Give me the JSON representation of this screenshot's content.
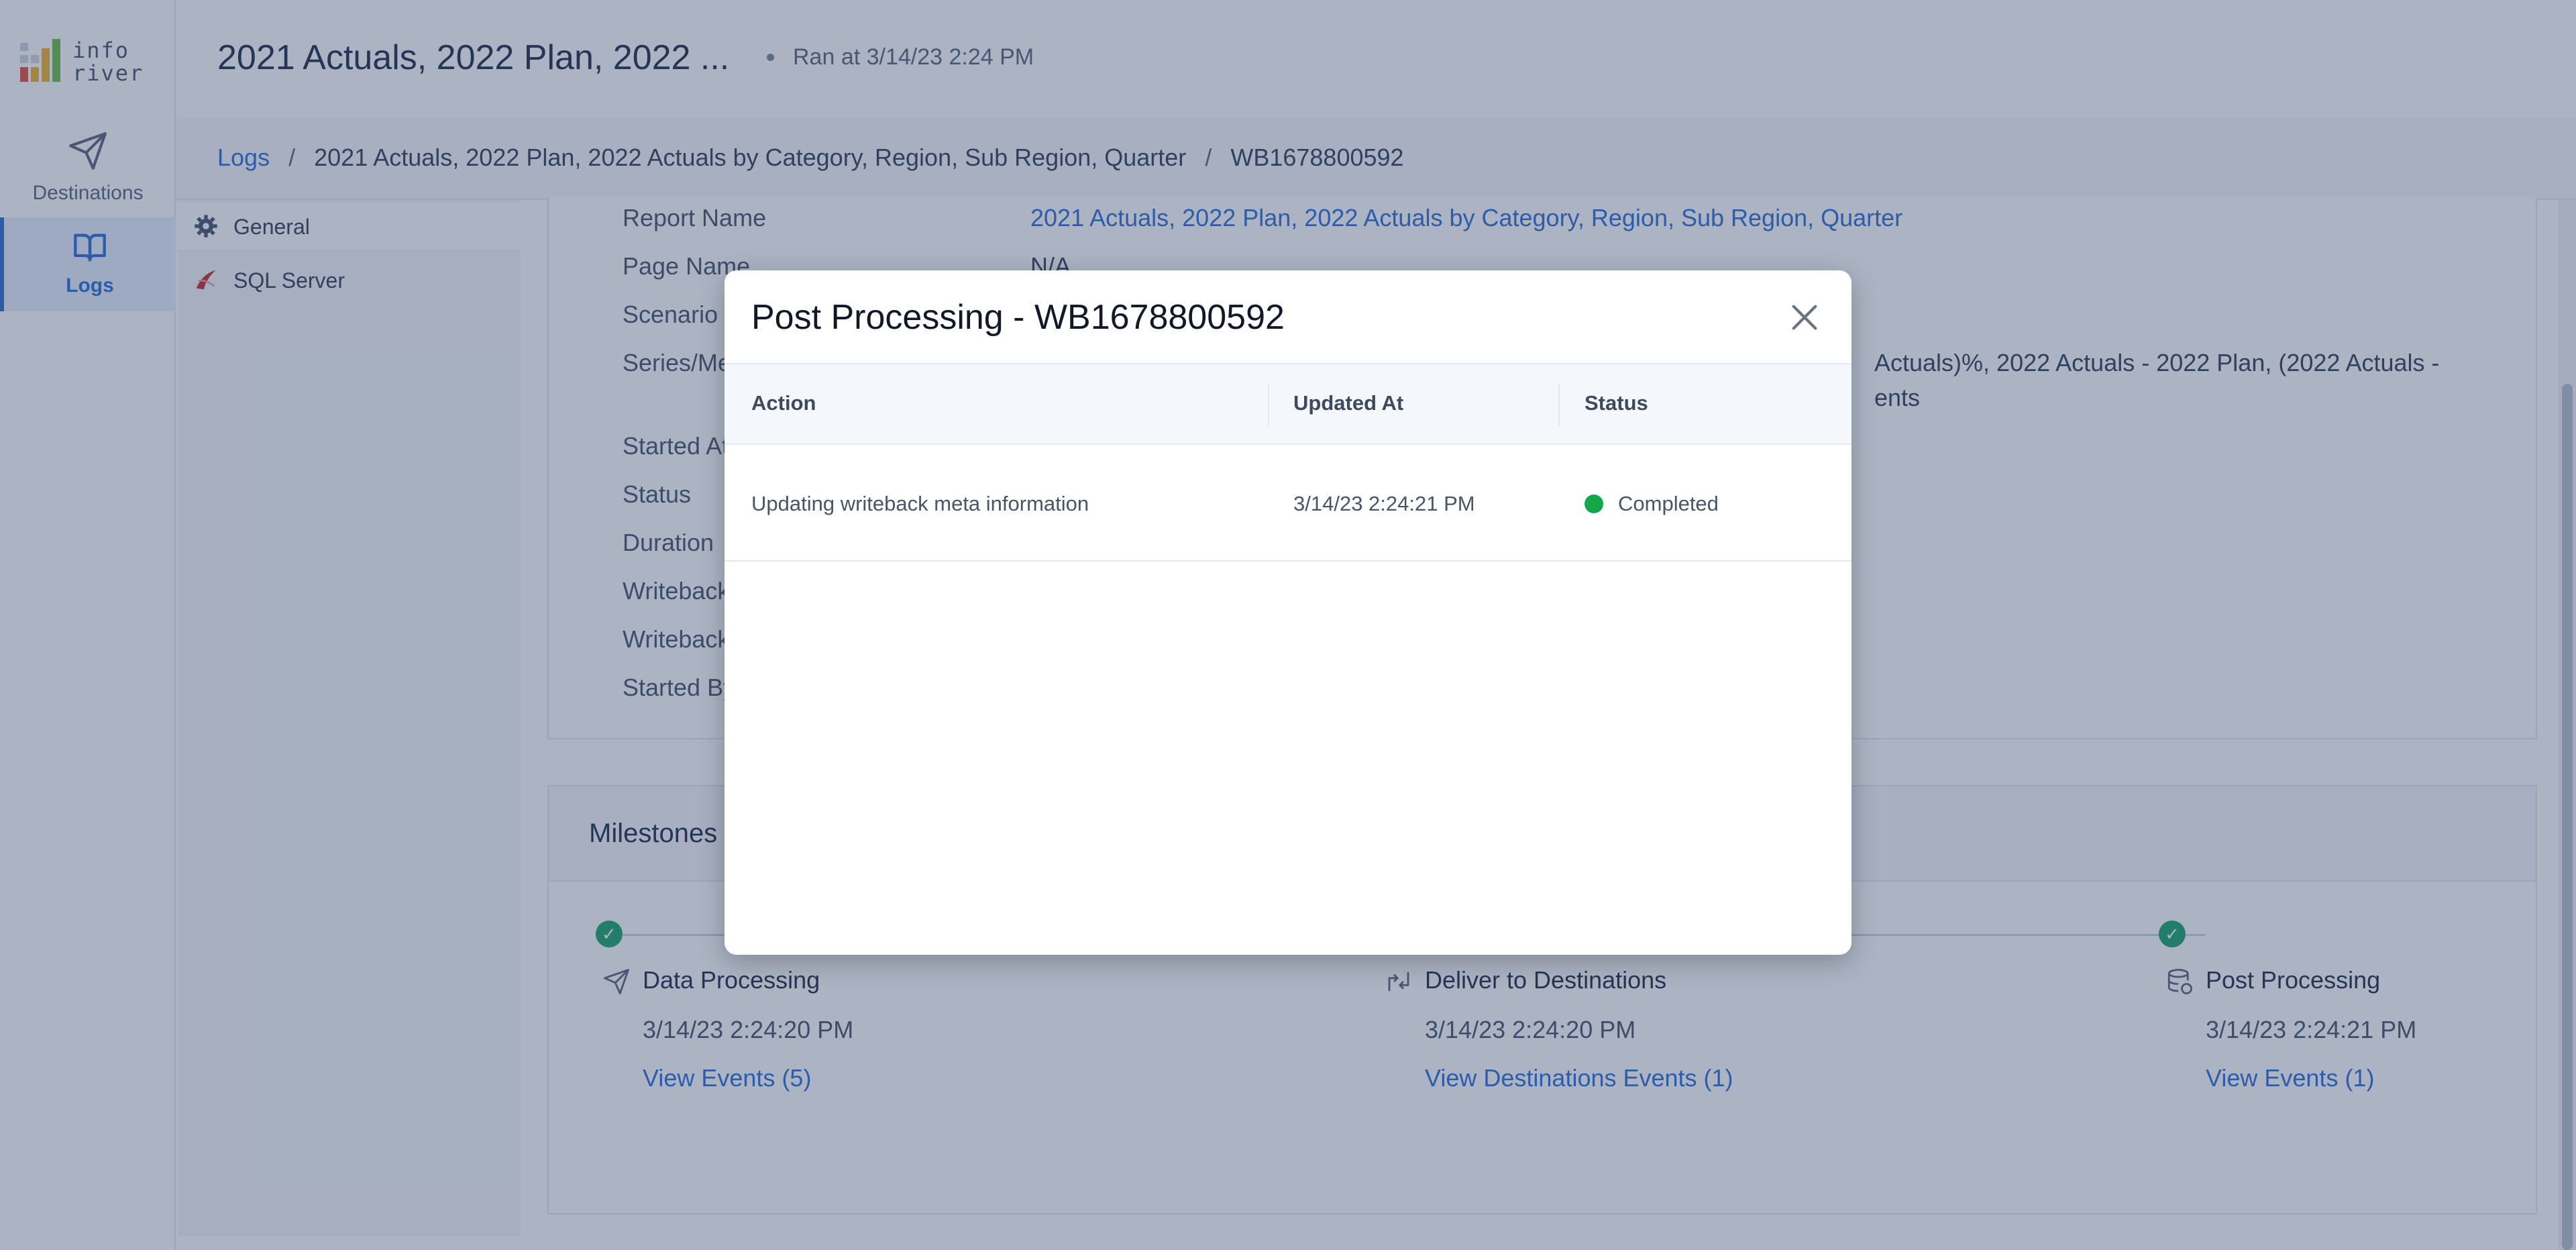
{
  "app": {
    "logo_text_line1": "info",
    "logo_text_line2": "river"
  },
  "header": {
    "title": "2021 Actuals, 2022 Plan, 2022 ...",
    "ran_at": "Ran at 3/14/23 2:24 PM"
  },
  "nav": {
    "destinations_label": "Destinations",
    "logs_label": "Logs"
  },
  "breadcrumb": {
    "root": "Logs",
    "report": "2021 Actuals, 2022 Plan, 2022 Actuals by Category, Region, Sub Region, Quarter",
    "id": "WB1678800592",
    "separator": "/"
  },
  "subnav": {
    "items": [
      {
        "label": "General",
        "icon": "gear-icon"
      },
      {
        "label": "SQL Server",
        "icon": "sql-server-icon"
      }
    ]
  },
  "details": {
    "report_name_label": "Report Name",
    "report_name_value": "2021 Actuals, 2022 Plan, 2022 Actuals by Category, Region, Sub Region, Quarter",
    "page_name_label": "Page Name",
    "page_name_value": "N/A",
    "scenario_label": "Scenario Na",
    "series_label": "Series/Meas",
    "series_value_line1": "Actuals)%, 2022 Actuals - 2022 Plan, (2022 Actuals -",
    "series_value_line2": "ents",
    "started_at_label": "Started At",
    "status_label": "Status",
    "duration_label": "Duration",
    "writeback_f_label": "Writeback F",
    "writeback_t_label": "Writeback T",
    "started_by_label": "Started By"
  },
  "milestones": {
    "title": "Milestones",
    "steps": [
      {
        "name": "Data Processing",
        "time": "3/14/23 2:24:20 PM",
        "link": "View Events (5)",
        "icon": "send-icon"
      },
      {
        "name": "Deliver to Destinations",
        "time": "3/14/23 2:24:20 PM",
        "link": "View Destinations Events (1)",
        "icon": "transfer-icon"
      },
      {
        "name": "Post Processing",
        "time": "3/14/23 2:24:21 PM",
        "link": "View Events (1)",
        "icon": "database-icon"
      }
    ],
    "check_glyph": "✓"
  },
  "modal": {
    "title": "Post Processing - WB1678800592",
    "columns": [
      "Action",
      "Updated At",
      "Status"
    ],
    "rows": [
      {
        "action": "Updating writeback meta information",
        "updated_at": "3/14/23 2:24:21 PM",
        "status": "Completed",
        "status_color": "#12a84a"
      }
    ]
  },
  "colors": {
    "accent": "#2b6fd6",
    "success": "#1aa569",
    "overlay": "rgba(47,66,104,0.4)"
  }
}
